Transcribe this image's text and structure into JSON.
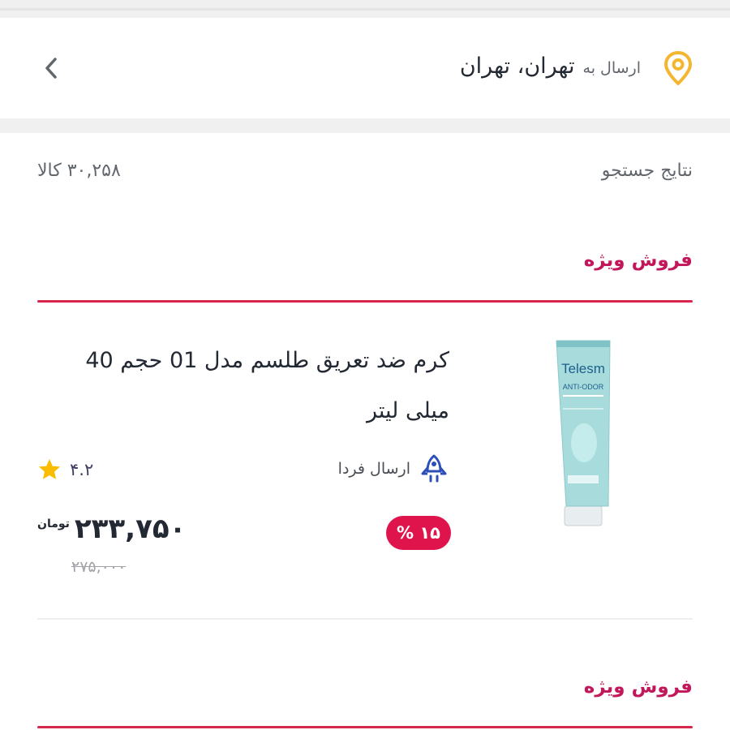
{
  "header": {
    "send_prefix": "ارسال به",
    "send_city": "تهران، تهران",
    "location_icon": "location-pin-icon",
    "back_icon": "chevron-left-icon"
  },
  "results": {
    "label": "نتایج جستجو",
    "count": "۳۰,۲۵۸ کالا"
  },
  "sections": [
    {
      "title": "فروش ویژه"
    },
    {
      "title": "فروش ویژه"
    }
  ],
  "product": {
    "title": "کرم ضد تعریق طلسم مدل 01 حجم 40 میلی لیتر",
    "delivery": "ارسال فردا",
    "rating": "۴.۲",
    "discount": "۱۵ %",
    "price": "۲۳۳,۷۵۰",
    "currency": "تومان",
    "old_price": "۲۷۵,۰۰۰",
    "image_brand": "Telesm",
    "image_subtitle": "ANTI-ODOR"
  },
  "colors": {
    "accent": "#d9264f",
    "badge": "#e0144c",
    "rating_star": "#f9bc00",
    "location_pin": "#f4b630",
    "delivery_icon": "#2c4fb8"
  }
}
